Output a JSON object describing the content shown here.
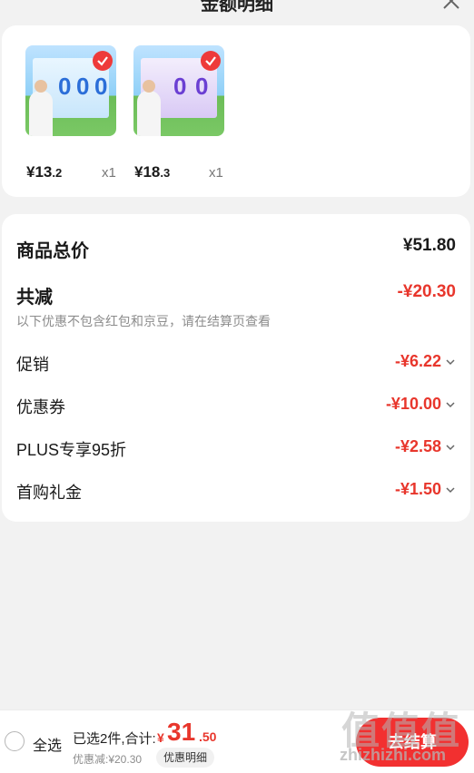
{
  "header": {
    "title": "金额明细",
    "close_icon": "close-icon"
  },
  "products": [
    {
      "price_int": "¥13",
      "price_dec": ".2",
      "qty": "x1",
      "thumb_theme": "blue",
      "selected": true
    },
    {
      "price_int": "¥18",
      "price_dec": ".3",
      "qty": "x1",
      "thumb_theme": "purple",
      "selected": true
    }
  ],
  "summary": {
    "total_label": "商品总价",
    "total_value": "¥51.80",
    "reduce_label": "共减",
    "reduce_value": "-¥20.30",
    "note": "以下优惠不包含红包和京豆，请在结算页查看",
    "items": [
      {
        "label": "促销",
        "value": "-¥6.22"
      },
      {
        "label": "优惠券",
        "value": "-¥10.00"
      },
      {
        "label": "PLUS专享95折",
        "value": "-¥2.58"
      },
      {
        "label": "首购礼金",
        "value": "-¥1.50"
      }
    ]
  },
  "bottom_bar": {
    "select_all": "全选",
    "selected_text": "已选2件,合计:",
    "currency": "¥",
    "total_int": "31",
    "total_dec": ".50",
    "discount_text": "优惠减:¥20.30",
    "discount_detail_button": "优惠明细",
    "checkout_button": "去结算"
  },
  "watermark": {
    "brand": "值",
    "site": "zhizhizhi.com"
  },
  "colors": {
    "accent_red": "#e8362c",
    "background": "#f2f2f2",
    "card": "#ffffff"
  }
}
